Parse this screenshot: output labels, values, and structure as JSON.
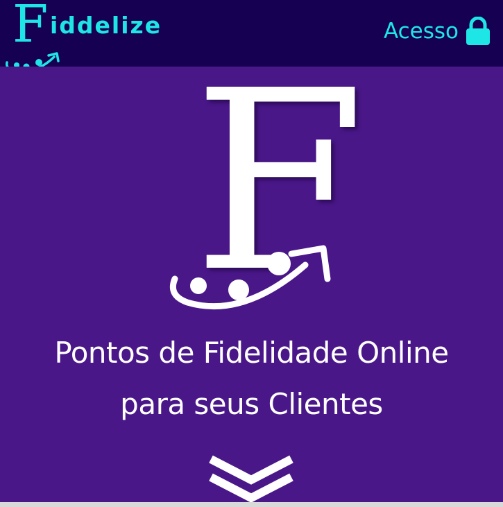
{
  "header": {
    "logo": {
      "letter": "F",
      "word": "iddelize",
      "icon": "swoosh-dots-icon"
    },
    "login": {
      "label": "Acesso",
      "icon": "lock-icon"
    }
  },
  "hero": {
    "logo_letter": "F",
    "logo_icon": "swoosh-dots-icon",
    "headline_line1": "Pontos de Fidelidade Online",
    "headline_line2": "para seus Clientes",
    "scroll_icon": "chevron-down-icon"
  },
  "colors": {
    "header_bg": "#150052",
    "hero_bg": "#4a1789",
    "accent": "#1fe6e6",
    "text": "#ffffff"
  }
}
